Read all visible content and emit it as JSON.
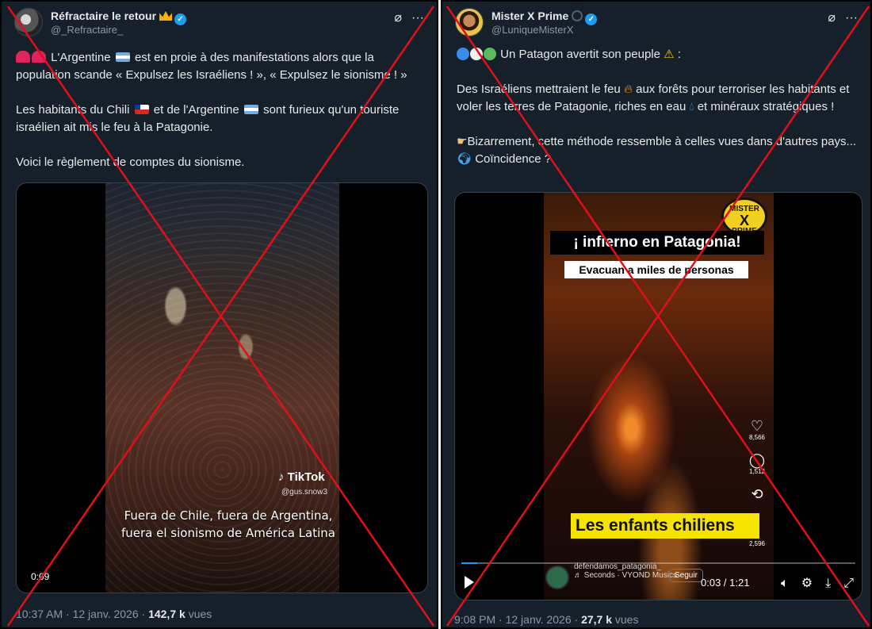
{
  "left_post": {
    "author_name": "Réfractaire le retour",
    "author_handle": "@_Refractaire_",
    "paragraphs": [
      "L'Argentine",
      "est en proie à des manifestations alors que la population scande « Expulsez les Israéliens ! », « Expulsez le sionisme ! »",
      "Les habitants du Chili",
      "et de l'Argentine",
      "sont furieux qu'un touriste israélien ait mis le feu à la Patagonie.",
      "Voici le règlement de comptes du sionisme."
    ],
    "video": {
      "caption_line1": "Fuera de Chile, fuera de Argentina,",
      "caption_line2": "fuera el sionismo de América Latina",
      "watermark": "TikTok",
      "watermark_user": "@gus.snow3",
      "duration": "0:09"
    },
    "footer": {
      "time": "10:37 AM · 12 janv. 2026 ·",
      "views_count": "142,7 k",
      "views_label": "vues"
    }
  },
  "right_post": {
    "author_name": "Mister X Prime",
    "author_handle": "@LuniqueMisterX",
    "line1": "Un Patagon avertit son peuple",
    "line1_end": ":",
    "para2_a": "Des Israéliens mettraient le feu",
    "para2_b": "aux forêts pour terroriser les habitants et voler les terres de Patagonie, riches en eau",
    "para2_c": "et minéraux stratégiques !",
    "para3_a": "Bizarrement, cette méthode ressemble à celles vues dans d'autres pays...",
    "para3_b": "Coïncidence ?",
    "video": {
      "banner_title": "¡ infierno en Patagonia!",
      "banner_sub": "Evacuan a miles de personas",
      "logo_line1": "MISTER",
      "logo_line2": "X",
      "logo_line3": "PRIME",
      "overlay": "Les enfants chiliens",
      "likes": "8,566",
      "comments": "1,512",
      "shares": "2,596",
      "tiktok_user": "defendamos_patagonia_",
      "music": "♬ Seconds · VYOND Musics",
      "follow": "Seguir",
      "time": "0:03 / 1:21",
      "progress": 0.04
    },
    "footer": {
      "time": "9:08 PM · 12 janv. 2026 ·",
      "views_count": "27,7 k",
      "views_label": "vues"
    }
  },
  "colors": {
    "background": "#15202b",
    "text": "#e7e9ea",
    "muted": "#8b98a5",
    "accent": "#1d9bf0",
    "cross": "#e0101a"
  },
  "icons": [
    "verified-icon",
    "grok-icon",
    "more-icon",
    "heart-icon",
    "comment-icon",
    "repost-icon",
    "play-icon",
    "volume-icon",
    "settings-icon",
    "fullscreen-icon"
  ]
}
